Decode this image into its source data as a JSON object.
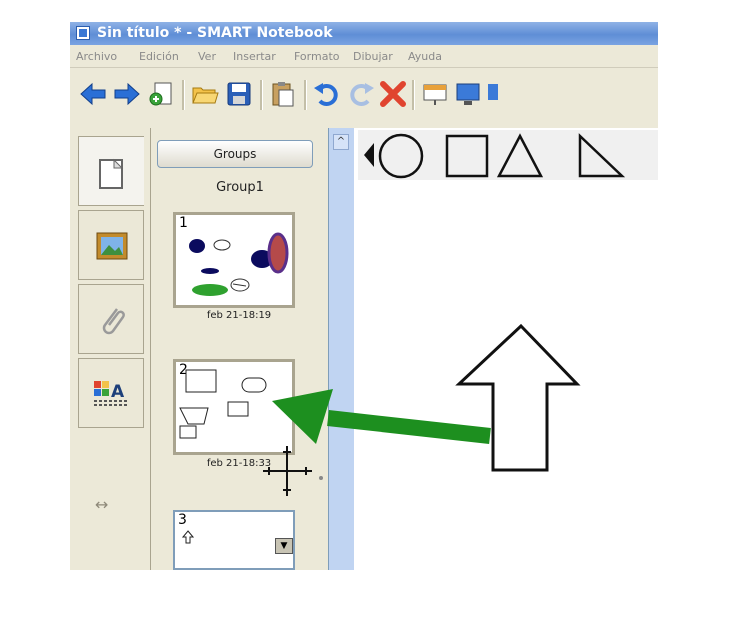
{
  "window": {
    "title": "Sin título * - SMART Notebook"
  },
  "menu": {
    "items": [
      "Archivo",
      "Edición",
      "Ver",
      "Insertar",
      "Formato",
      "Dibujar",
      "Ayuda"
    ]
  },
  "toolbar": {
    "buttons": [
      "back-arrow-icon",
      "forward-arrow-icon",
      "add-page-icon",
      "open-folder-icon",
      "save-icon",
      "paste-icon",
      "undo-icon",
      "redo-icon",
      "delete-icon",
      "screen-shade-icon",
      "display-icon"
    ]
  },
  "side_tabs": [
    "page-sorter-icon",
    "gallery-icon",
    "attachments-icon",
    "properties-icon"
  ],
  "sorter": {
    "groups_button": "Groups",
    "group_name": "Group1",
    "pages": [
      {
        "number": "1",
        "date": "feb 21-18:19"
      },
      {
        "number": "2",
        "date": "feb 21-18:33"
      },
      {
        "number": "3"
      }
    ]
  },
  "shapes_palette": [
    "arrow-left-icon",
    "circle-icon",
    "square-icon",
    "triangle-icon",
    "right-triangle-icon"
  ],
  "canvas": {
    "objects": [
      "up-arrow-shape",
      "green-pointer-arrow"
    ]
  },
  "colors": {
    "titlebar": "#5f8ed6",
    "panel": "#ece9d8",
    "green_arrow": "#1d8f1f",
    "scroll_track": "#c0d4f2"
  }
}
